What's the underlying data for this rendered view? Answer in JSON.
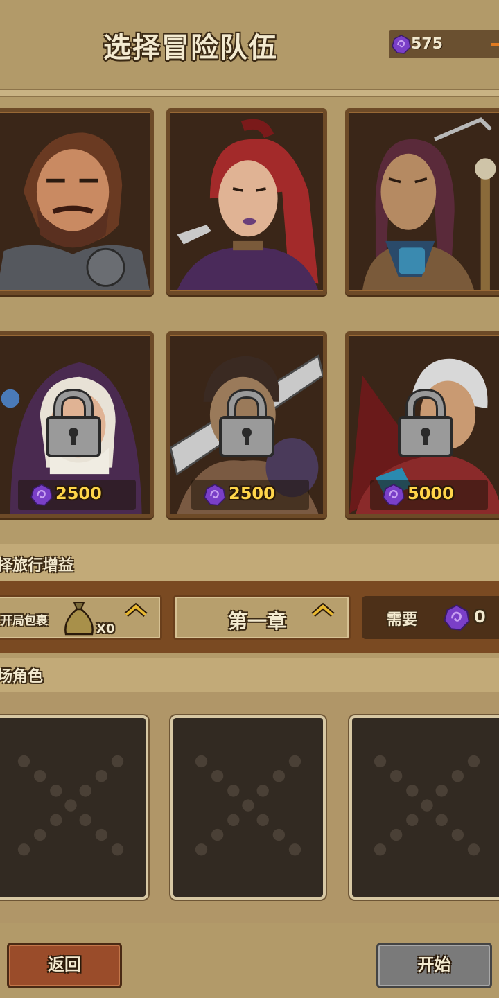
{
  "header": {
    "title": "选择冒险队伍",
    "gems": "575"
  },
  "heroes": [
    {
      "name": "warrior",
      "locked": false
    },
    {
      "name": "rogue",
      "locked": false
    },
    {
      "name": "shaman",
      "locked": false
    },
    {
      "name": "nun",
      "locked": true,
      "price": "2500"
    },
    {
      "name": "swordsman",
      "locked": true,
      "price": "2500"
    },
    {
      "name": "mage",
      "locked": true,
      "price": "5000"
    }
  ],
  "buff": {
    "section_label": "择旅行增益",
    "pack_label": "开局包裹",
    "pack_count": "X0",
    "chapter": "第一章",
    "need_label": "需要",
    "need_value": "0"
  },
  "slots": {
    "section_label": "场角色"
  },
  "buttons": {
    "back": "返回",
    "start": "开始"
  },
  "colors": {
    "gem": "#7a3fc8",
    "price": "#ffd54a",
    "chevron": "#e8b830"
  }
}
